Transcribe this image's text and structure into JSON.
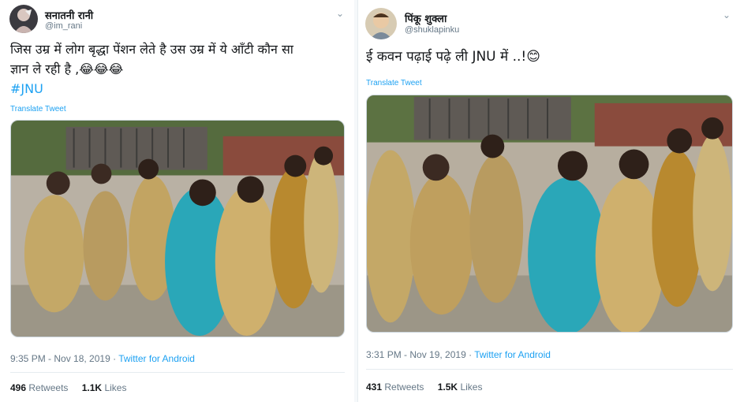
{
  "tweets": [
    {
      "display_name": "सनातनी रानी",
      "handle": "@im_rani",
      "text_line1": "जिस उम्र में लोग बृद्धा पेंशन लेते है  उस उम्र में ये आँटी कौन सा",
      "text_line2": "ज्ञान ले रही है ,😂😂😂",
      "hashtag": "#JNU",
      "translate": "Translate Tweet",
      "time": "9:35 PM - Nov 18, 2019",
      "dot": " · ",
      "via": "Twitter for Android",
      "retweets_count": "496",
      "retweets_label": "Retweets",
      "likes_count": "1.1K",
      "likes_label": "Likes"
    },
    {
      "display_name": "पिंकू शुक्ला",
      "handle": "@shuklapinku",
      "text_line1": "ई कवन पढ़ाई पढ़े ली JNU में ..!😊",
      "translate": "Translate Tweet",
      "time": "3:31 PM - Nov 19, 2019",
      "dot": " · ",
      "via": "Twitter for Android",
      "retweets_count": "431",
      "retweets_label": "Retweets",
      "likes_count": "1.5K",
      "likes_label": "Likes"
    }
  ],
  "icons": {
    "more": "chevron-down-icon"
  },
  "colors": {
    "link": "#1da1f2",
    "muted": "#657786",
    "text": "#14171a",
    "divider": "#e6ecf0"
  }
}
